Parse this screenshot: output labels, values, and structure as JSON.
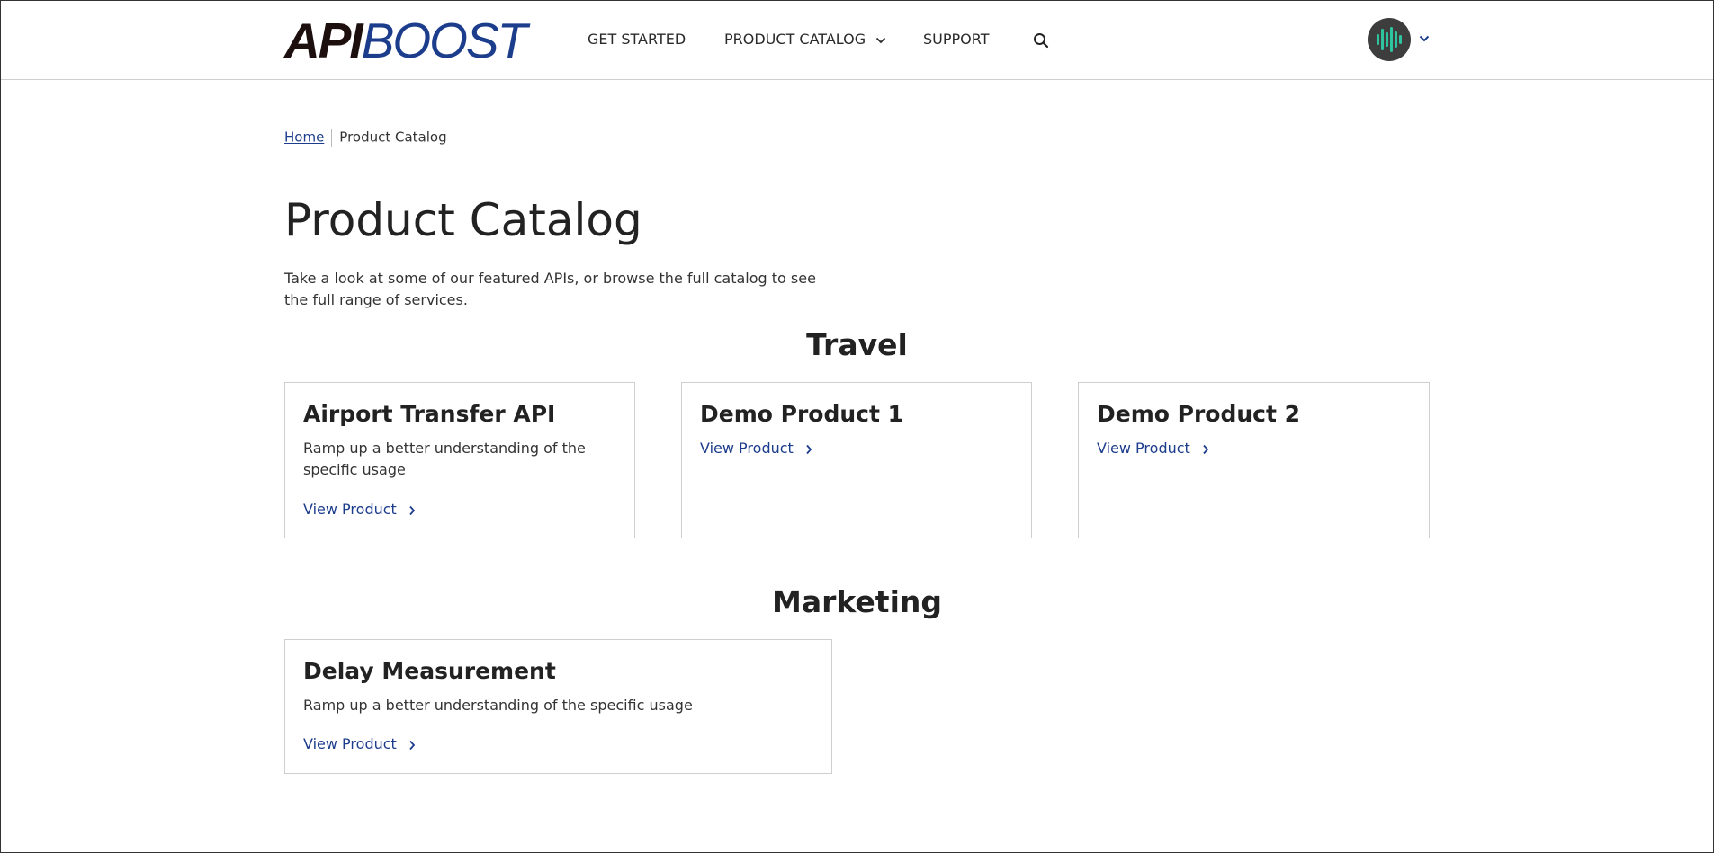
{
  "header": {
    "logo_bold": "API",
    "logo_thin": "BOOST",
    "nav": {
      "get_started": "GET STARTED",
      "product_catalog": "PRODUCT CATALOG",
      "support": "SUPPORT"
    },
    "icons": [
      "search-icon",
      "chevron-down-icon",
      "avatar"
    ]
  },
  "breadcrumb": {
    "home": "Home",
    "current": "Product Catalog"
  },
  "page": {
    "title": "Product Catalog",
    "intro": "Take a look at some of our featured APIs, or browse the full catalog to see the full range of services."
  },
  "sections": [
    {
      "title": "Travel",
      "cards": [
        {
          "title": "Airport Transfer API",
          "description": "Ramp up a better understanding of the specific usage",
          "link": "View Product"
        },
        {
          "title": "Demo Product 1",
          "link": "View Product"
        },
        {
          "title": "Demo Product 2",
          "link": "View Product"
        }
      ]
    },
    {
      "title": "Marketing",
      "cards": [
        {
          "title": "Delay Measurement",
          "description": "Ramp up a better understanding of the specific usage",
          "link": "View Product"
        }
      ]
    }
  ],
  "colors": {
    "link": "#1c3c8c",
    "logo_dark": "#1c0f0d",
    "avatar_bg": "#3d3d3d",
    "avatar_bars": "#2ec4a0"
  }
}
